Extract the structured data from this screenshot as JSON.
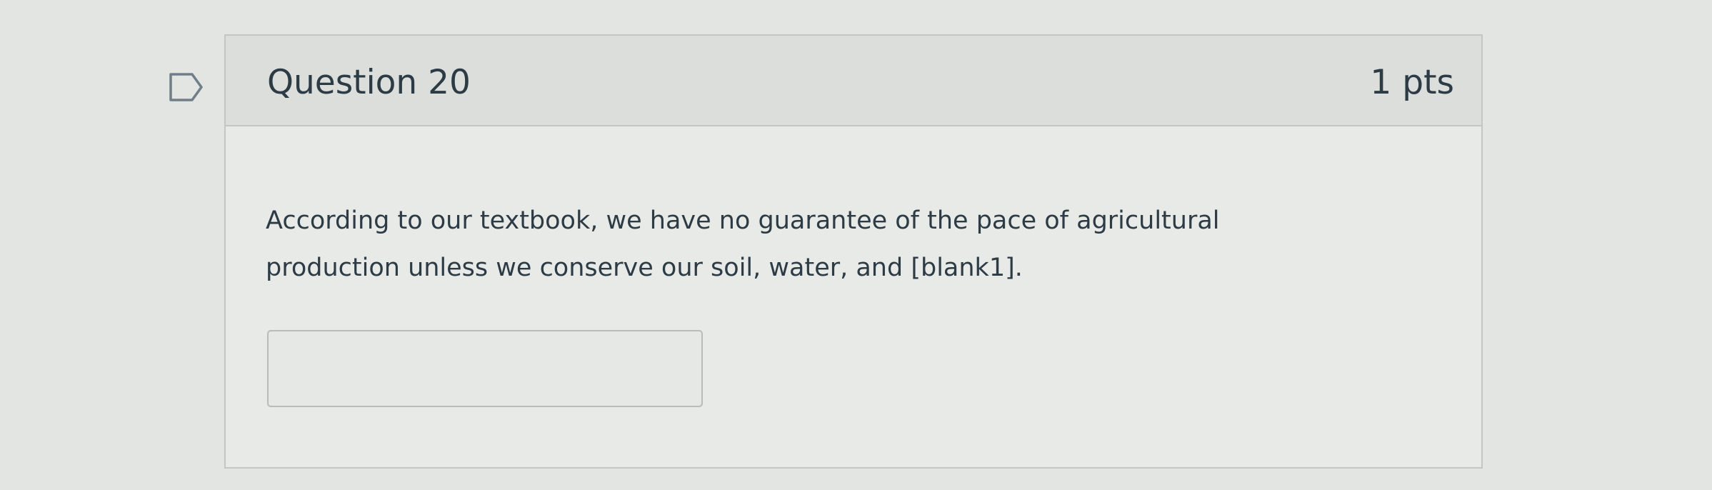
{
  "question": {
    "title": "Question 20",
    "points": "1 pts",
    "text": "According to our textbook, we have no guarantee of the pace of agricultural production unless we conserve our soil, water, and [blank1].",
    "answer_value": "",
    "answer_placeholder": ""
  },
  "icons": {
    "flag": "flag-question-icon"
  }
}
